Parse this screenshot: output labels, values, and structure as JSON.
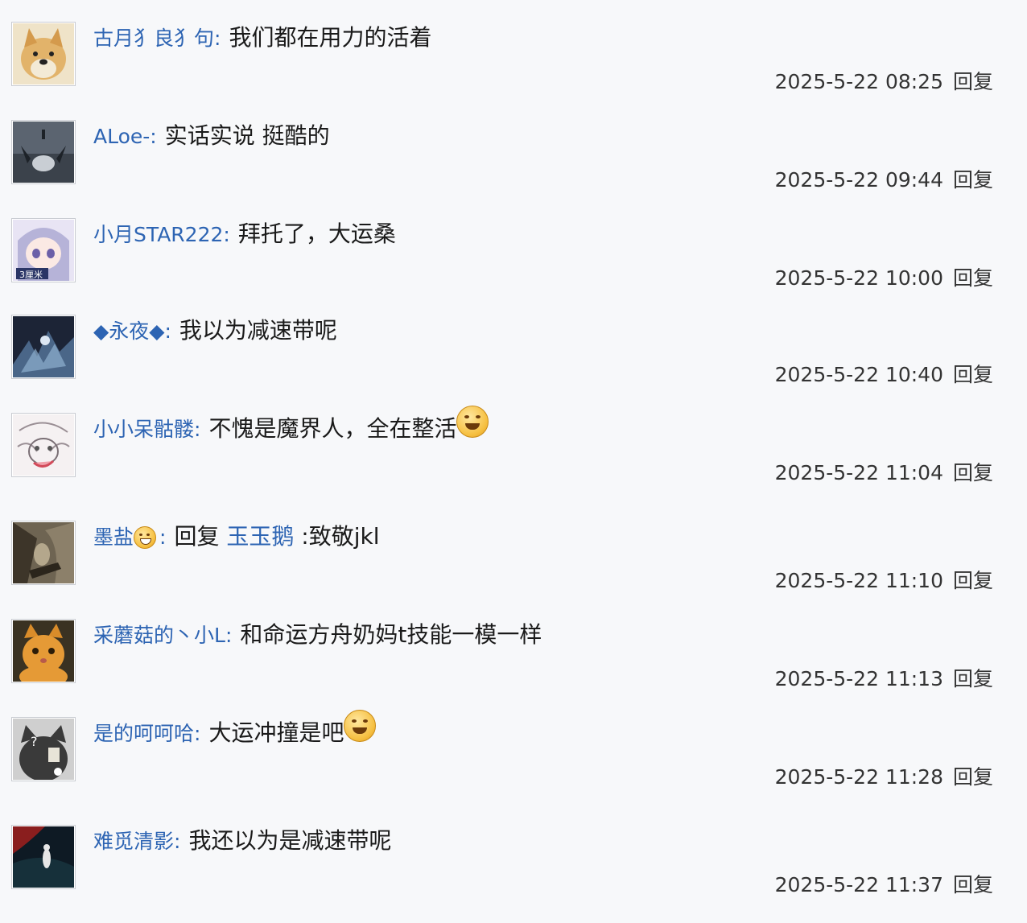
{
  "reply_label": "回复",
  "comments": [
    {
      "user": "古月犭良犭句",
      "text": "我们都在用力的活着",
      "time": "2025-5-22 08:25",
      "avatar": "doge-avatar"
    },
    {
      "user": "ALoe-",
      "text": "实话实说 挺酷的",
      "time": "2025-5-22 09:44",
      "avatar": "dark-figure-avatar"
    },
    {
      "user": "小月STAR222",
      "text": "拜托了，大运桑",
      "time": "2025-5-22 10:00",
      "avatar": "anime-girl-avatar"
    },
    {
      "user": "◆永夜◆",
      "text": "我以为减速带呢",
      "time": "2025-5-22 10:40",
      "avatar": "dark-fantasy-avatar"
    },
    {
      "user": "小小呆骷髅",
      "text": "不愧是魔界人，全在整活",
      "time": "2025-5-22 11:04",
      "avatar": "sketch-avatar"
    },
    {
      "user": "墨盐",
      "reply_label": "回复",
      "reply_to": "玉玉鹅",
      "text": ":致敬jkl",
      "time": "2025-5-22 11:10",
      "avatar": "sepia-scene-avatar"
    },
    {
      "user": "采蘑菇的丶小L",
      "text": "和命运方舟奶妈t技能一模一样",
      "time": "2025-5-22 11:13",
      "avatar": "orange-cat-avatar"
    },
    {
      "user": "是的呵呵哈",
      "text": "大运冲撞是吧",
      "time": "2025-5-22 11:28",
      "avatar": "cat-question-avatar"
    },
    {
      "user": "难觅清影",
      "text": "我还以为是减速带呢",
      "time": "2025-5-22 11:37",
      "avatar": "dark-red-scene-avatar"
    }
  ]
}
